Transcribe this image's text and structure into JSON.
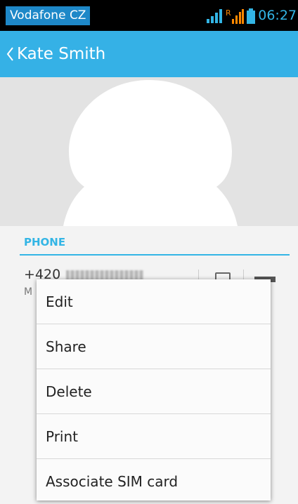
{
  "status_bar": {
    "carrier": "Vodafone CZ",
    "roaming_indicator": "R",
    "time": "06:27",
    "icons": [
      "signal-icon",
      "roaming-signal-icon",
      "battery-icon"
    ],
    "colors": {
      "carrier_bg": "#1e88c8",
      "accent": "#33b5e5"
    }
  },
  "action_bar": {
    "title": "Kate Smith",
    "color": "#35b1e6"
  },
  "contact": {
    "section_header": "PHONE",
    "phone_prefix": "+420",
    "phone_type_initial": "M"
  },
  "menu": {
    "items": [
      {
        "label": "Edit"
      },
      {
        "label": "Share"
      },
      {
        "label": "Delete"
      },
      {
        "label": "Print"
      },
      {
        "label": "Associate SIM card"
      }
    ]
  }
}
